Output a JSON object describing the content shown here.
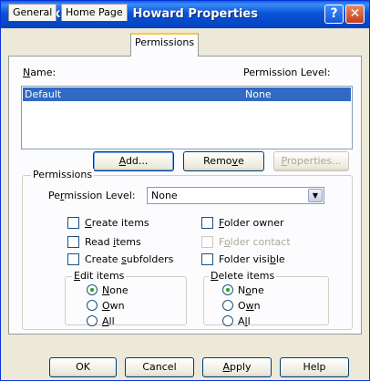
{
  "window": {
    "title": "Mailbox - Hudson, Howard Properties",
    "help_button": "?",
    "close_button": "✕"
  },
  "tabs": [
    {
      "label": "General"
    },
    {
      "label": "Home Page"
    },
    {
      "label": "Permissions",
      "active": true
    }
  ],
  "list": {
    "name_prefix": "",
    "name_underlined": "N",
    "name_suffix": "ame:",
    "level_header": "Permission Level:",
    "rows": [
      {
        "name": "Default",
        "level": "None",
        "selected": true
      }
    ]
  },
  "buttons": {
    "add": {
      "p": "",
      "u": "A",
      "s": "dd..."
    },
    "remove": {
      "p": "Remo",
      "u": "v",
      "s": "e"
    },
    "properties": {
      "p": "",
      "u": "P",
      "s": "roperties..."
    }
  },
  "permissions": {
    "group_title": "Permissions",
    "level_label": {
      "p": "Pe",
      "u": "r",
      "s": "mission Level:"
    },
    "level_value": "None",
    "checkboxes": {
      "create_items": {
        "p": "",
        "u": "C",
        "s": "reate items",
        "checked": false
      },
      "read_items": {
        "p": "Read ",
        "u": "i",
        "s": "tems",
        "checked": false
      },
      "create_subfolders": {
        "p": "Create ",
        "u": "s",
        "s": "ubfolders",
        "checked": false
      },
      "folder_owner": {
        "p": "",
        "u": "F",
        "s": "older owner",
        "checked": false
      },
      "folder_contact": {
        "p": "F",
        "u": "o",
        "s": "lder contact",
        "checked": false,
        "disabled": true
      },
      "folder_visible": {
        "p": "Folder visi",
        "u": "b",
        "s": "le",
        "checked": false
      }
    },
    "edit_items": {
      "title_p": "",
      "title_u": "E",
      "title_s": "dit items",
      "options": [
        {
          "p": "",
          "u": "N",
          "s": "one",
          "selected": true
        },
        {
          "p": "",
          "u": "O",
          "s": "wn",
          "selected": false
        },
        {
          "p": "",
          "u": "A",
          "s": "ll",
          "selected": false
        }
      ]
    },
    "delete_items": {
      "title_p": "",
      "title_u": "D",
      "title_s": "elete items",
      "options": [
        {
          "p": "N",
          "u": "o",
          "s": "ne",
          "selected": true
        },
        {
          "p": "O",
          "u": "w",
          "s": "n",
          "selected": false
        },
        {
          "p": "A",
          "u": "l",
          "s": "l",
          "selected": false
        }
      ]
    }
  },
  "footer": {
    "ok": "OK",
    "cancel": "Cancel",
    "apply": {
      "p": "",
      "u": "A",
      "s": "pply"
    },
    "help": "Help"
  }
}
